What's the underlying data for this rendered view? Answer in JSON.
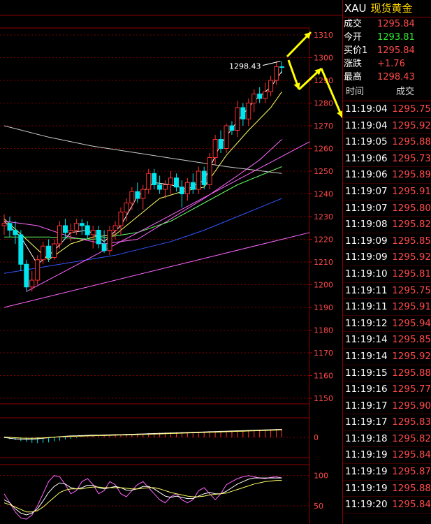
{
  "header": {
    "symbol": "XAU",
    "name": "现货黄金"
  },
  "quote": [
    {
      "label": "成交",
      "value": "1295.84",
      "color": "#ff4a4a"
    },
    {
      "label": "今开",
      "value": "1293.81",
      "color": "#32e632"
    },
    {
      "label": "买价1",
      "value": "1295.84",
      "color": "#ff4a4a"
    },
    {
      "label": "涨跌",
      "value": "+1.76",
      "color": "#ff4a4a"
    },
    {
      "label": "最高",
      "value": "1298.43",
      "color": "#ff4a4a"
    }
  ],
  "ticks_header": {
    "time": "时间",
    "price": "成交"
  },
  "ticks": [
    {
      "time": "11:19:04",
      "price": "1295.75"
    },
    {
      "time": "11:19:04",
      "price": "1295.92"
    },
    {
      "time": "11:19:05",
      "price": "1295.88"
    },
    {
      "time": "11:19:06",
      "price": "1295.73"
    },
    {
      "time": "11:19:06",
      "price": "1295.89"
    },
    {
      "time": "11:19:07",
      "price": "1295.91"
    },
    {
      "time": "11:19:07",
      "price": "1295.80"
    },
    {
      "time": "11:19:08",
      "price": "1295.82"
    },
    {
      "time": "11:19:09",
      "price": "1295.85"
    },
    {
      "time": "11:19:09",
      "price": "1295.92"
    },
    {
      "time": "11:19:10",
      "price": "1295.81"
    },
    {
      "time": "11:19:11",
      "price": "1295.75"
    },
    {
      "time": "11:19:11",
      "price": "1295.91"
    },
    {
      "time": "11:19:12",
      "price": "1295.94"
    },
    {
      "time": "11:19:14",
      "price": "1295.85"
    },
    {
      "time": "11:19:14",
      "price": "1295.92"
    },
    {
      "time": "11:19:15",
      "price": "1295.88"
    },
    {
      "time": "11:19:16",
      "price": "1295.77"
    },
    {
      "time": "11:19:17",
      "price": "1295.90"
    },
    {
      "time": "11:19:17",
      "price": "1295.83"
    },
    {
      "time": "11:19:18",
      "price": "1295.82"
    },
    {
      "time": "11:19:19",
      "price": "1295.84"
    },
    {
      "time": "11:19:19",
      "price": "1295.87"
    },
    {
      "time": "11:19:19",
      "price": "1295.88"
    },
    {
      "time": "11:19:20",
      "price": "1295.84"
    }
  ],
  "chart_data": [
    {
      "type": "candlestick",
      "ylim": [
        1150,
        1310
      ],
      "yticks": [
        1150,
        1160,
        1170,
        1180,
        1190,
        1200,
        1210,
        1220,
        1230,
        1240,
        1250,
        1260,
        1270,
        1280,
        1290,
        1300,
        1310
      ],
      "up_color": "#ff3030",
      "down_color": "#00e5ee",
      "annotations": [
        {
          "text": "1298.43",
          "value": 1298.43
        }
      ],
      "candles": [
        {
          "o": 1226,
          "h": 1231,
          "l": 1222,
          "c": 1227
        },
        {
          "o": 1227,
          "h": 1230,
          "l": 1221,
          "c": 1224
        },
        {
          "o": 1224,
          "h": 1228,
          "l": 1218,
          "c": 1222
        },
        {
          "o": 1222,
          "h": 1224,
          "l": 1206,
          "c": 1209
        },
        {
          "o": 1209,
          "h": 1211,
          "l": 1197,
          "c": 1199
        },
        {
          "o": 1199,
          "h": 1206,
          "l": 1197,
          "c": 1202
        },
        {
          "o": 1202,
          "h": 1213,
          "l": 1200,
          "c": 1211
        },
        {
          "o": 1211,
          "h": 1219,
          "l": 1209,
          "c": 1217
        },
        {
          "o": 1217,
          "h": 1220,
          "l": 1210,
          "c": 1212
        },
        {
          "o": 1212,
          "h": 1220,
          "l": 1211,
          "c": 1218
        },
        {
          "o": 1218,
          "h": 1228,
          "l": 1216,
          "c": 1226
        },
        {
          "o": 1226,
          "h": 1229,
          "l": 1220,
          "c": 1223
        },
        {
          "o": 1223,
          "h": 1227,
          "l": 1219,
          "c": 1224
        },
        {
          "o": 1224,
          "h": 1229,
          "l": 1222,
          "c": 1227
        },
        {
          "o": 1227,
          "h": 1229,
          "l": 1222,
          "c": 1226
        },
        {
          "o": 1226,
          "h": 1228,
          "l": 1220,
          "c": 1222
        },
        {
          "o": 1222,
          "h": 1226,
          "l": 1216,
          "c": 1224
        },
        {
          "o": 1224,
          "h": 1226,
          "l": 1216,
          "c": 1218
        },
        {
          "o": 1218,
          "h": 1224,
          "l": 1214,
          "c": 1215
        },
        {
          "o": 1215,
          "h": 1226,
          "l": 1213,
          "c": 1224
        },
        {
          "o": 1224,
          "h": 1228,
          "l": 1220,
          "c": 1226
        },
        {
          "o": 1226,
          "h": 1234,
          "l": 1222,
          "c": 1232
        },
        {
          "o": 1232,
          "h": 1238,
          "l": 1228,
          "c": 1236
        },
        {
          "o": 1236,
          "h": 1243,
          "l": 1233,
          "c": 1241
        },
        {
          "o": 1241,
          "h": 1245,
          "l": 1236,
          "c": 1238
        },
        {
          "o": 1238,
          "h": 1244,
          "l": 1233,
          "c": 1242
        },
        {
          "o": 1242,
          "h": 1251,
          "l": 1240,
          "c": 1249
        },
        {
          "o": 1249,
          "h": 1251,
          "l": 1242,
          "c": 1244
        },
        {
          "o": 1244,
          "h": 1248,
          "l": 1240,
          "c": 1242
        },
        {
          "o": 1242,
          "h": 1246,
          "l": 1238,
          "c": 1244
        },
        {
          "o": 1244,
          "h": 1250,
          "l": 1240,
          "c": 1247
        },
        {
          "o": 1247,
          "h": 1249,
          "l": 1241,
          "c": 1243
        },
        {
          "o": 1243,
          "h": 1246,
          "l": 1234,
          "c": 1240
        },
        {
          "o": 1240,
          "h": 1247,
          "l": 1237,
          "c": 1245
        },
        {
          "o": 1245,
          "h": 1249,
          "l": 1240,
          "c": 1242
        },
        {
          "o": 1242,
          "h": 1252,
          "l": 1240,
          "c": 1250
        },
        {
          "o": 1250,
          "h": 1252,
          "l": 1242,
          "c": 1244
        },
        {
          "o": 1244,
          "h": 1258,
          "l": 1242,
          "c": 1256
        },
        {
          "o": 1256,
          "h": 1266,
          "l": 1253,
          "c": 1264
        },
        {
          "o": 1264,
          "h": 1268,
          "l": 1258,
          "c": 1260
        },
        {
          "o": 1260,
          "h": 1271,
          "l": 1258,
          "c": 1270
        },
        {
          "o": 1270,
          "h": 1272,
          "l": 1266,
          "c": 1268
        },
        {
          "o": 1268,
          "h": 1281,
          "l": 1265,
          "c": 1278
        },
        {
          "o": 1278,
          "h": 1280,
          "l": 1270,
          "c": 1273
        },
        {
          "o": 1273,
          "h": 1282,
          "l": 1270,
          "c": 1280
        },
        {
          "o": 1280,
          "h": 1286,
          "l": 1276,
          "c": 1284
        },
        {
          "o": 1284,
          "h": 1287,
          "l": 1280,
          "c": 1282
        },
        {
          "o": 1282,
          "h": 1289,
          "l": 1280,
          "c": 1285
        },
        {
          "o": 1285,
          "h": 1292,
          "l": 1283,
          "c": 1290
        },
        {
          "o": 1290,
          "h": 1298.43,
          "l": 1288,
          "c": 1296
        },
        {
          "o": 1296,
          "h": 1298.43,
          "l": 1293,
          "c": 1295.84
        }
      ],
      "lines": [
        {
          "color": "#ffffff",
          "points": [
            [
              0,
              1228
            ],
            [
              3,
              1221
            ],
            [
              6,
              1209
            ],
            [
              9,
              1215
            ],
            [
              12,
              1223
            ],
            [
              15,
              1224
            ],
            [
              18,
              1219
            ],
            [
              21,
              1226
            ],
            [
              24,
              1239
            ],
            [
              27,
              1245
            ],
            [
              30,
              1244
            ],
            [
              33,
              1242
            ],
            [
              36,
              1246
            ],
            [
              39,
              1262
            ],
            [
              42,
              1272
            ],
            [
              45,
              1281
            ],
            [
              48,
              1287
            ],
            [
              50,
              1294
            ]
          ]
        },
        {
          "color": "#ffff66",
          "points": [
            [
              0,
              1229
            ],
            [
              4,
              1220
            ],
            [
              8,
              1211
            ],
            [
              12,
              1218
            ],
            [
              16,
              1221
            ],
            [
              20,
              1222
            ],
            [
              24,
              1230
            ],
            [
              28,
              1238
            ],
            [
              32,
              1241
            ],
            [
              36,
              1243
            ],
            [
              40,
              1257
            ],
            [
              44,
              1268
            ],
            [
              48,
              1278
            ],
            [
              50,
              1285
            ]
          ]
        },
        {
          "color": "#ff66ff",
          "points": [
            [
              0,
              1228
            ],
            [
              6,
              1226
            ],
            [
              12,
              1221
            ],
            [
              18,
              1218
            ],
            [
              24,
              1220
            ],
            [
              30,
              1229
            ],
            [
              36,
              1238
            ],
            [
              42,
              1248
            ],
            [
              46,
              1255
            ],
            [
              50,
              1264
            ]
          ]
        },
        {
          "color": "#66ff66",
          "points": [
            [
              0,
              1221
            ],
            [
              8,
              1221
            ],
            [
              16,
              1220
            ],
            [
              24,
              1223
            ],
            [
              30,
              1228
            ],
            [
              36,
              1236
            ],
            [
              42,
              1244
            ],
            [
              46,
              1248
            ],
            [
              50,
              1252
            ]
          ]
        },
        {
          "color": "#3355ff",
          "points": [
            [
              0,
              1205
            ],
            [
              10,
              1209
            ],
            [
              20,
              1213
            ],
            [
              30,
              1219
            ],
            [
              36,
              1224
            ],
            [
              42,
              1230
            ],
            [
              47,
              1235
            ],
            [
              50,
              1238
            ]
          ]
        },
        {
          "color": "#cccccc",
          "points": [
            [
              0,
              1270
            ],
            [
              8,
              1265
            ],
            [
              16,
              1261
            ],
            [
              24,
              1258
            ],
            [
              32,
              1255
            ],
            [
              40,
              1252
            ],
            [
              50,
              1249
            ]
          ]
        },
        {
          "color": "#ff66ff",
          "points": [
            [
              0,
              1190
            ],
            [
              55,
              1223
            ]
          ]
        },
        {
          "color": "#ff66ff",
          "points": [
            [
              4,
              1197
            ],
            [
              55,
              1263
            ]
          ]
        }
      ]
    },
    {
      "type": "bar",
      "title": "",
      "ylim": [
        -1,
        1
      ],
      "yticks": [
        0
      ],
      "values": [
        -0.05,
        -0.1,
        -0.15,
        -0.2,
        -0.25,
        -0.3,
        -0.32,
        -0.3,
        -0.28,
        -0.22,
        -0.18,
        -0.12,
        -0.08,
        -0.04,
        0.02,
        0.05,
        0.08,
        0.1,
        0.12,
        0.13,
        0.14,
        0.15,
        0.16,
        0.18,
        0.2,
        0.22,
        0.24,
        0.25,
        0.26,
        0.27,
        0.28,
        0.29,
        0.3,
        0.3,
        0.31,
        0.32,
        0.33,
        0.34,
        0.35,
        0.36,
        0.37,
        0.38,
        0.39,
        0.4,
        0.41,
        0.42,
        0.43,
        0.44,
        0.45,
        0.46,
        0.47
      ],
      "lines": [
        {
          "color": "#ffffff",
          "values": [
            0,
            -0.05,
            -0.08,
            -0.1,
            -0.11,
            -0.1,
            -0.08,
            -0.05,
            -0.02,
            0.01,
            0.04,
            0.06,
            0.08,
            0.09,
            0.1,
            0.11,
            0.12,
            0.12,
            0.13,
            0.14,
            0.15,
            0.15,
            0.16,
            0.17,
            0.18,
            0.19,
            0.2,
            0.21,
            0.22,
            0.23,
            0.24,
            0.25,
            0.26,
            0.27,
            0.28,
            0.29,
            0.3,
            0.31,
            0.32,
            0.33,
            0.34,
            0.35,
            0.36,
            0.37,
            0.38,
            0.39,
            0.4,
            0.41,
            0.42,
            0.43,
            0.44
          ]
        },
        {
          "color": "#ffff66",
          "values": [
            0.02,
            0,
            -0.02,
            -0.04,
            -0.05,
            -0.05,
            -0.04,
            -0.03,
            -0.01,
            0.01,
            0.03,
            0.04,
            0.05,
            0.06,
            0.07,
            0.08,
            0.09,
            0.1,
            0.1,
            0.11,
            0.12,
            0.13,
            0.13,
            0.14,
            0.15,
            0.16,
            0.17,
            0.18,
            0.19,
            0.2,
            0.21,
            0.22,
            0.23,
            0.24,
            0.25,
            0.26,
            0.27,
            0.28,
            0.29,
            0.3,
            0.31,
            0.32,
            0.33,
            0.34,
            0.35,
            0.36,
            0.37,
            0.38,
            0.39,
            0.4,
            0.41
          ]
        }
      ]
    },
    {
      "type": "line",
      "title": "",
      "ylim": [
        20,
        110
      ],
      "yticks": [
        50,
        100
      ],
      "series": [
        {
          "color": "#ff66ff",
          "values": [
            70,
            55,
            40,
            30,
            28,
            35,
            50,
            70,
            90,
            100,
            98,
            85,
            70,
            75,
            90,
            95,
            85,
            70,
            75,
            90,
            85,
            70,
            65,
            75,
            85,
            90,
            80,
            70,
            60,
            55,
            65,
            70,
            60,
            55,
            60,
            75,
            80,
            70,
            60,
            70,
            85,
            90,
            95,
            98,
            100,
            98,
            96,
            95,
            97,
            98,
            96
          ]
        },
        {
          "color": "#ffffff",
          "values": [
            60,
            55,
            45,
            38,
            35,
            38,
            45,
            58,
            72,
            82,
            88,
            86,
            80,
            78,
            80,
            84,
            84,
            80,
            78,
            80,
            82,
            80,
            76,
            76,
            78,
            82,
            82,
            78,
            72,
            66,
            64,
            66,
            64,
            62,
            62,
            66,
            70,
            72,
            70,
            70,
            74,
            80,
            86,
            90,
            94,
            96,
            96,
            96,
            96,
            96,
            96
          ]
        },
        {
          "color": "#ffff66",
          "values": [
            55,
            52,
            48,
            44,
            40,
            40,
            42,
            48,
            56,
            64,
            72,
            76,
            78,
            78,
            78,
            80,
            81,
            81,
            80,
            80,
            80,
            80,
            79,
            78,
            78,
            79,
            80,
            80,
            78,
            75,
            72,
            70,
            68,
            66,
            65,
            65,
            66,
            68,
            69,
            70,
            71,
            74,
            77,
            80,
            83,
            86,
            88,
            90,
            91,
            92,
            92
          ]
        }
      ]
    }
  ]
}
